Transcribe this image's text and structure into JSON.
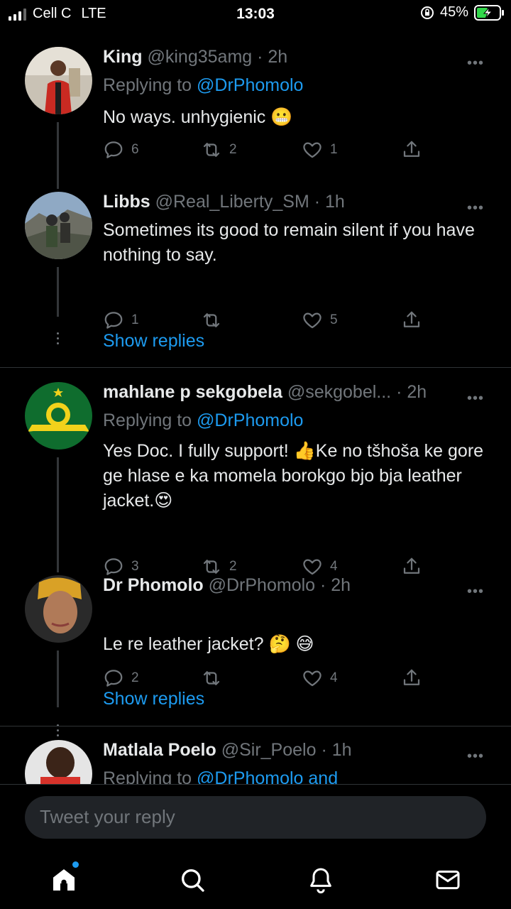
{
  "status": {
    "carrier": "Cell C",
    "network": "LTE",
    "time": "13:03",
    "battery": "45%",
    "icons": [
      "signal-icon",
      "orientation-lock-icon",
      "battery-charging-icon"
    ]
  },
  "tweets": [
    {
      "name": "King",
      "handle": "@king35amg · 2h",
      "replying_prefix": "Replying to ",
      "replying_to": "@DrPhomolo",
      "text": "No ways. unhygienic 😬",
      "replies": "6",
      "retweets": "2",
      "likes": "1"
    },
    {
      "name": "Libbs",
      "handle": "@Real_Liberty_SM · 1h",
      "text": "Sometimes its good to remain silent if you have nothing to say.",
      "replies": "1",
      "retweets": "",
      "likes": "5",
      "show_replies": "Show replies"
    },
    {
      "name": "mahlane p sekgobela",
      "handle": "@sekgobel... · 2h",
      "replying_prefix": "Replying to ",
      "replying_to": "@DrPhomolo",
      "text": "Yes Doc. I fully support! 👍Ke no tšhoša ke gore ge hlase e ka momela borokgo bjo bja leather jacket.😍",
      "replies": "3",
      "retweets": "2",
      "likes": "4"
    },
    {
      "name": "Dr Phomolo",
      "handle": "@DrPhomolo · 2h",
      "text": "Le re leather jacket? 🤔 😅",
      "replies": "2",
      "retweets": "",
      "likes": "4",
      "show_replies": "Show replies"
    },
    {
      "name": "Matlala Poelo",
      "handle": "@Sir_Poelo · 1h",
      "replying_prefix": "Replying to ",
      "replying_to": "@DrPhomolo and"
    }
  ],
  "composer": {
    "placeholder": "Tweet your reply"
  },
  "tabbar": {
    "icons": [
      "home-icon",
      "search-icon",
      "notifications-icon",
      "messages-icon"
    ]
  },
  "colors": {
    "background": "#000000",
    "link": "#1d9bf0",
    "muted": "#71767b",
    "text": "#e7e9ea"
  }
}
